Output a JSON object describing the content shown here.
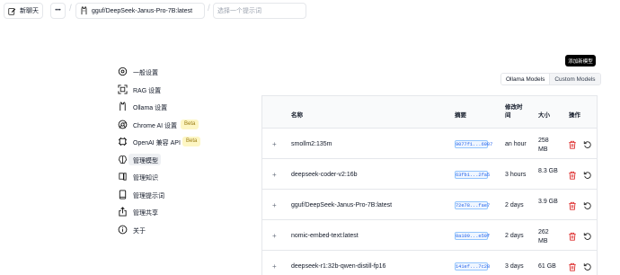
{
  "topbar": {
    "new_chat_label": "新聊天",
    "more_label": "•••",
    "model_name": "gguf/DeepSeek-Janus-Pro-7B:latest",
    "separator": "/",
    "prompt_placeholder": "选择一个提示词"
  },
  "sidebar": {
    "items": [
      {
        "label": "一般设置",
        "icon": "settings-gear-icon"
      },
      {
        "label": "RAG 设置",
        "icon": "rag-scan-icon"
      },
      {
        "label": "Ollama 设置",
        "icon": "ollama-llama-icon"
      },
      {
        "label": "Chrome AI 设置",
        "icon": "chrome-icon",
        "badge": "Beta"
      },
      {
        "label": "OpenAI 兼容 API",
        "icon": "api-chip-icon",
        "badge": "Beta"
      },
      {
        "label": "管理模型",
        "icon": "brain-icon"
      },
      {
        "label": "管理知识",
        "icon": "knowledge-book-icon"
      },
      {
        "label": "管理提示词",
        "icon": "prompt-book-icon"
      },
      {
        "label": "管理共享",
        "icon": "share-icon"
      },
      {
        "label": "关于",
        "icon": "info-icon"
      }
    ],
    "active_index": 5
  },
  "actions": {
    "add_model_label": "添加新模型",
    "tabs": [
      "Ollama Models",
      "Custom Models"
    ],
    "active_tab": 0
  },
  "table": {
    "headers": [
      "名称",
      "摘要",
      "修改时间",
      "大小",
      "操作"
    ],
    "rows": [
      {
        "name": "smollm2:135m",
        "digest": "9077f1...6907",
        "modified": "an hour",
        "size": "258 MB"
      },
      {
        "name": "deepseek-coder-v2:16b",
        "digest": "63fb1...2fa5",
        "modified": "3 hours",
        "size": "8.3 GB"
      },
      {
        "name": "gguf/DeepSeek-Janus-Pro-7B:latest",
        "digest": "72e78...fae7",
        "modified": "2 days",
        "size": "3.9 GB"
      },
      {
        "name": "nomic-embed-text:latest",
        "digest": "0a109...e59f",
        "modified": "2 days",
        "size": "262 MB"
      },
      {
        "name": "deepseek-r1:32b-qwen-distill-fp16",
        "digest": "141ef...7c28",
        "modified": "3 days",
        "size": "61 GB"
      }
    ],
    "expand_symbol": "+"
  },
  "colors": {
    "accent_black": "#000000",
    "delete_red": "#dc2626",
    "digest_blue": "#2563eb",
    "badge_yellow": "#fdf6c4"
  }
}
